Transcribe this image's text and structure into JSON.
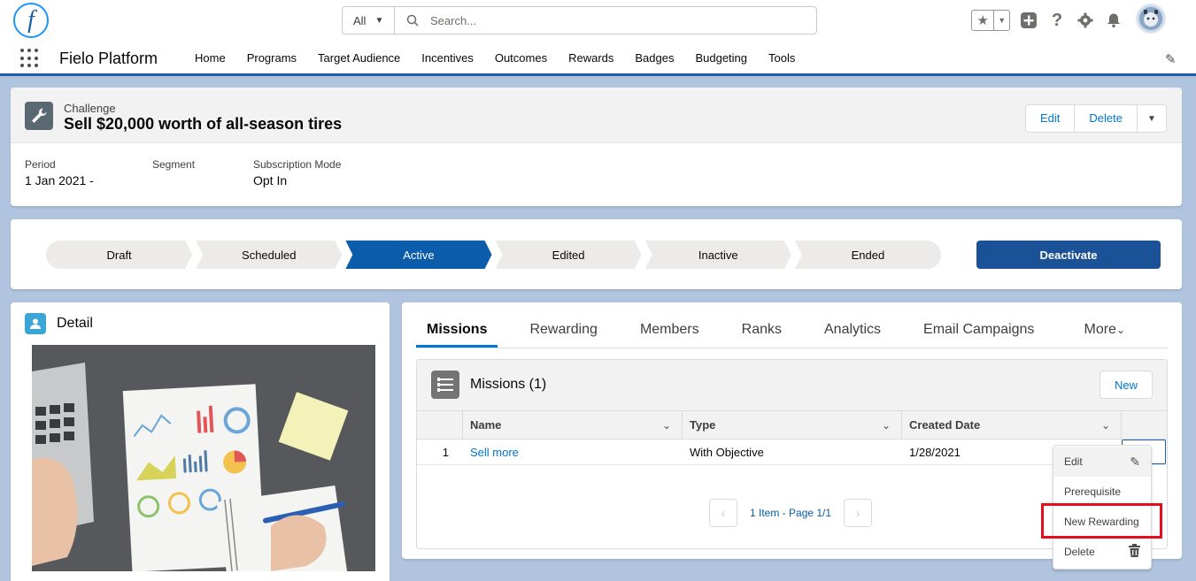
{
  "global_header": {
    "search_scope": "All",
    "search_placeholder": "Search...",
    "icons": [
      "star-icon",
      "chevron-down-icon",
      "add-icon",
      "help-icon",
      "gear-icon",
      "bell-icon",
      "avatar"
    ]
  },
  "nav": {
    "app_name": "Fielo Platform",
    "items": [
      "Home",
      "Programs",
      "Target Audience",
      "Incentives",
      "Outcomes",
      "Rewards",
      "Badges",
      "Budgeting",
      "Tools"
    ]
  },
  "record": {
    "type": "Challenge",
    "title": "Sell $20,000 worth of all-season tires",
    "buttons": {
      "edit": "Edit",
      "delete": "Delete"
    },
    "fields": [
      {
        "label": "Period",
        "value": "1 Jan 2021 -"
      },
      {
        "label": "Segment",
        "value": ""
      },
      {
        "label": "Subscription Mode",
        "value": "Opt In"
      }
    ]
  },
  "path": {
    "stages": [
      "Draft",
      "Scheduled",
      "Active",
      "Edited",
      "Inactive",
      "Ended"
    ],
    "active_stage": "Active",
    "action_label": "Deactivate"
  },
  "detail": {
    "title": "Detail"
  },
  "tabs": {
    "items": [
      "Missions",
      "Rewarding",
      "Members",
      "Ranks",
      "Analytics",
      "Email Campaigns"
    ],
    "more_label": "More",
    "active": "Missions"
  },
  "missions": {
    "title": "Missions (1)",
    "new_label": "New",
    "columns": [
      "Name",
      "Type",
      "Created Date"
    ],
    "rows": [
      {
        "num": "1",
        "name": "Sell more",
        "type": "With Objective",
        "created": "1/28/2021"
      }
    ],
    "pager_text": "1 Item - Page 1/1"
  },
  "row_menu": {
    "items": [
      "Edit",
      "Prerequisite",
      "New Rewarding",
      "Delete"
    ],
    "highlighted": "New Rewarding"
  },
  "colors": {
    "brand": "#0176d3",
    "active_stage": "#0b5cab",
    "deactivate": "#1b5297",
    "highlight": "#e50e1a"
  }
}
